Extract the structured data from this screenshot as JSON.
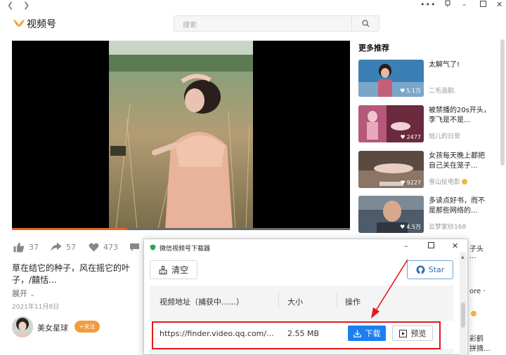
{
  "header": {
    "logo_text": "视频号",
    "search_placeholder": "搜索"
  },
  "video": {
    "progress": 0.34,
    "likes": "37",
    "shares": "57",
    "hearts": "473",
    "description": "草在结它的种子，风在摇它的叶子，/囍恬...",
    "expand_label": "展开",
    "date": "2021年11月8日",
    "author": "美女星球",
    "follow_label": "+关注"
  },
  "recommend": {
    "title": "更多推荐",
    "items": [
      {
        "title": "太解气了!",
        "author": "二毛追剧.",
        "likes": "5.1万",
        "verified": false
      },
      {
        "title": "被禁播的20s开头，李飞是不是...",
        "author": "旭儿的日常",
        "likes": "2477",
        "verified": false
      },
      {
        "title": "女孩每天晚上都把自己关在笼子...",
        "author": "雪山扯电影",
        "likes": "9227",
        "verified": true
      },
      {
        "title": "多读点好书，而不是那些网络的...",
        "author": "云梦家纺168",
        "likes": "4.5万",
        "verified": false
      }
    ]
  },
  "behind_text": {
    "line1": "子头",
    "line2": "...",
    "line3": "ore ·",
    "line4": "彩鹤",
    "line5": "拼摘..."
  },
  "dialog": {
    "title": "微信视频号下载器",
    "clear_label": "清空",
    "star_label": "Star",
    "columns": [
      "视频地址（捕获中......）",
      "大小",
      "操作"
    ],
    "row": {
      "url": "https://finder.video.qq.com/...",
      "size": "2.55 MB",
      "download_label": "下载",
      "preview_label": "预览"
    }
  }
}
